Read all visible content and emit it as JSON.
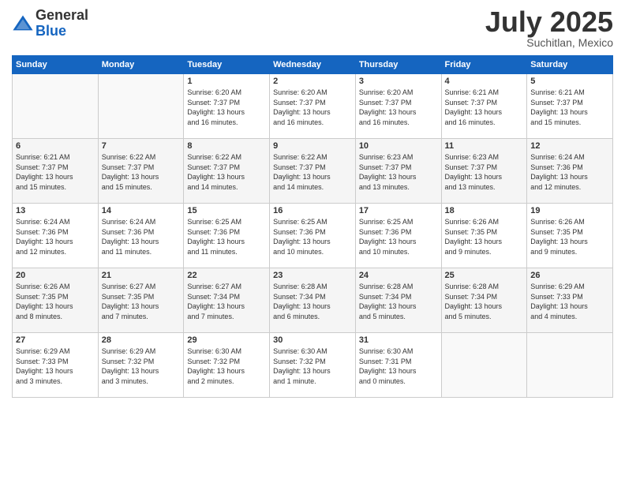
{
  "logo": {
    "general": "General",
    "blue": "Blue"
  },
  "header": {
    "month": "July 2025",
    "location": "Suchitlan, Mexico"
  },
  "weekdays": [
    "Sunday",
    "Monday",
    "Tuesday",
    "Wednesday",
    "Thursday",
    "Friday",
    "Saturday"
  ],
  "weeks": [
    [
      {
        "day": "",
        "info": ""
      },
      {
        "day": "",
        "info": ""
      },
      {
        "day": "1",
        "info": "Sunrise: 6:20 AM\nSunset: 7:37 PM\nDaylight: 13 hours\nand 16 minutes."
      },
      {
        "day": "2",
        "info": "Sunrise: 6:20 AM\nSunset: 7:37 PM\nDaylight: 13 hours\nand 16 minutes."
      },
      {
        "day": "3",
        "info": "Sunrise: 6:20 AM\nSunset: 7:37 PM\nDaylight: 13 hours\nand 16 minutes."
      },
      {
        "day": "4",
        "info": "Sunrise: 6:21 AM\nSunset: 7:37 PM\nDaylight: 13 hours\nand 16 minutes."
      },
      {
        "day": "5",
        "info": "Sunrise: 6:21 AM\nSunset: 7:37 PM\nDaylight: 13 hours\nand 15 minutes."
      }
    ],
    [
      {
        "day": "6",
        "info": "Sunrise: 6:21 AM\nSunset: 7:37 PM\nDaylight: 13 hours\nand 15 minutes."
      },
      {
        "day": "7",
        "info": "Sunrise: 6:22 AM\nSunset: 7:37 PM\nDaylight: 13 hours\nand 15 minutes."
      },
      {
        "day": "8",
        "info": "Sunrise: 6:22 AM\nSunset: 7:37 PM\nDaylight: 13 hours\nand 14 minutes."
      },
      {
        "day": "9",
        "info": "Sunrise: 6:22 AM\nSunset: 7:37 PM\nDaylight: 13 hours\nand 14 minutes."
      },
      {
        "day": "10",
        "info": "Sunrise: 6:23 AM\nSunset: 7:37 PM\nDaylight: 13 hours\nand 13 minutes."
      },
      {
        "day": "11",
        "info": "Sunrise: 6:23 AM\nSunset: 7:37 PM\nDaylight: 13 hours\nand 13 minutes."
      },
      {
        "day": "12",
        "info": "Sunrise: 6:24 AM\nSunset: 7:36 PM\nDaylight: 13 hours\nand 12 minutes."
      }
    ],
    [
      {
        "day": "13",
        "info": "Sunrise: 6:24 AM\nSunset: 7:36 PM\nDaylight: 13 hours\nand 12 minutes."
      },
      {
        "day": "14",
        "info": "Sunrise: 6:24 AM\nSunset: 7:36 PM\nDaylight: 13 hours\nand 11 minutes."
      },
      {
        "day": "15",
        "info": "Sunrise: 6:25 AM\nSunset: 7:36 PM\nDaylight: 13 hours\nand 11 minutes."
      },
      {
        "day": "16",
        "info": "Sunrise: 6:25 AM\nSunset: 7:36 PM\nDaylight: 13 hours\nand 10 minutes."
      },
      {
        "day": "17",
        "info": "Sunrise: 6:25 AM\nSunset: 7:36 PM\nDaylight: 13 hours\nand 10 minutes."
      },
      {
        "day": "18",
        "info": "Sunrise: 6:26 AM\nSunset: 7:35 PM\nDaylight: 13 hours\nand 9 minutes."
      },
      {
        "day": "19",
        "info": "Sunrise: 6:26 AM\nSunset: 7:35 PM\nDaylight: 13 hours\nand 9 minutes."
      }
    ],
    [
      {
        "day": "20",
        "info": "Sunrise: 6:26 AM\nSunset: 7:35 PM\nDaylight: 13 hours\nand 8 minutes."
      },
      {
        "day": "21",
        "info": "Sunrise: 6:27 AM\nSunset: 7:35 PM\nDaylight: 13 hours\nand 7 minutes."
      },
      {
        "day": "22",
        "info": "Sunrise: 6:27 AM\nSunset: 7:34 PM\nDaylight: 13 hours\nand 7 minutes."
      },
      {
        "day": "23",
        "info": "Sunrise: 6:28 AM\nSunset: 7:34 PM\nDaylight: 13 hours\nand 6 minutes."
      },
      {
        "day": "24",
        "info": "Sunrise: 6:28 AM\nSunset: 7:34 PM\nDaylight: 13 hours\nand 5 minutes."
      },
      {
        "day": "25",
        "info": "Sunrise: 6:28 AM\nSunset: 7:34 PM\nDaylight: 13 hours\nand 5 minutes."
      },
      {
        "day": "26",
        "info": "Sunrise: 6:29 AM\nSunset: 7:33 PM\nDaylight: 13 hours\nand 4 minutes."
      }
    ],
    [
      {
        "day": "27",
        "info": "Sunrise: 6:29 AM\nSunset: 7:33 PM\nDaylight: 13 hours\nand 3 minutes."
      },
      {
        "day": "28",
        "info": "Sunrise: 6:29 AM\nSunset: 7:32 PM\nDaylight: 13 hours\nand 3 minutes."
      },
      {
        "day": "29",
        "info": "Sunrise: 6:30 AM\nSunset: 7:32 PM\nDaylight: 13 hours\nand 2 minutes."
      },
      {
        "day": "30",
        "info": "Sunrise: 6:30 AM\nSunset: 7:32 PM\nDaylight: 13 hours\nand 1 minute."
      },
      {
        "day": "31",
        "info": "Sunrise: 6:30 AM\nSunset: 7:31 PM\nDaylight: 13 hours\nand 0 minutes."
      },
      {
        "day": "",
        "info": ""
      },
      {
        "day": "",
        "info": ""
      }
    ]
  ]
}
